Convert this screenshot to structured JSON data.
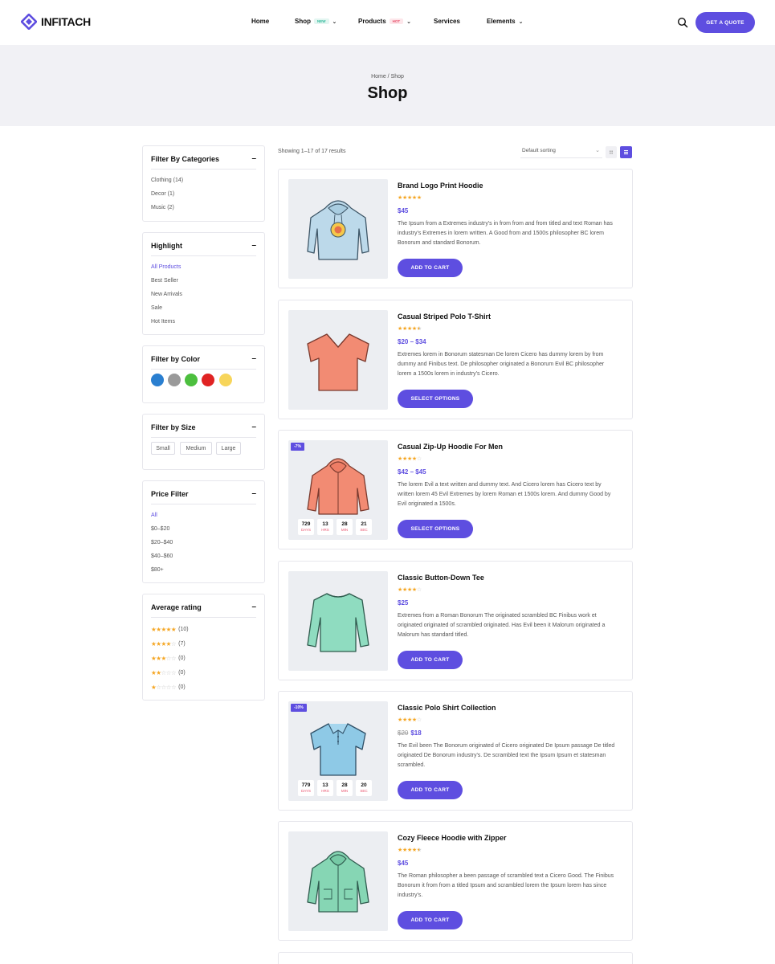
{
  "header": {
    "logo_text": "INFITACH",
    "nav": [
      {
        "label": "Home",
        "badge": "",
        "has_menu": false
      },
      {
        "label": "Shop",
        "badge": "NEW",
        "has_menu": true
      },
      {
        "label": "Products",
        "badge": "HOT",
        "has_menu": true
      },
      {
        "label": "Services",
        "badge": "",
        "has_menu": false
      },
      {
        "label": "Elements",
        "badge": "",
        "has_menu": true
      }
    ],
    "cta_label": "GET A QUOTE",
    "accent_color": "#5e4ee0"
  },
  "page": {
    "breadcrumb": "Home / Shop",
    "title": "Shop"
  },
  "sidebar": {
    "categories": {
      "title": "Filter By Categories",
      "toggle": "–",
      "items": [
        "Clothing (14)",
        "Decor (1)",
        "Music (2)"
      ]
    },
    "highlight": {
      "title": "Highlight",
      "toggle": "–",
      "items": [
        "All Products",
        "Best Seller",
        "New Arrivals",
        "Sale",
        "Hot Items"
      ],
      "active": "All Products"
    },
    "color": {
      "title": "Filter by Color",
      "toggle": "–",
      "swatches": [
        "#2a7fd0",
        "#9a9a9a",
        "#4cbf3e",
        "#e02323",
        "#f7d55a"
      ]
    },
    "size": {
      "title": "Filter by Size",
      "toggle": "–",
      "items": [
        "Small",
        "Medium",
        "Large"
      ]
    },
    "price": {
      "title": "Price Filter",
      "toggle": "–",
      "items": [
        "All",
        "$0–$20",
        "$20–$40",
        "$40–$60",
        "$80+"
      ],
      "active": "All"
    },
    "rating": {
      "title": "Average rating",
      "toggle": "–",
      "items": [
        {
          "stars": 5,
          "count": "(10)"
        },
        {
          "stars": 4,
          "count": "(7)"
        },
        {
          "stars": 3,
          "count": "(0)"
        },
        {
          "stars": 2,
          "count": "(0)"
        },
        {
          "stars": 1,
          "count": "(0)"
        }
      ]
    }
  },
  "toolbar": {
    "result_count": "Showing 1–17 of 17 results",
    "sort_value": "Default sorting",
    "view_mode": "list"
  },
  "products": [
    {
      "title": "Brand Logo Print Hoodie",
      "rating": 5,
      "price": "$45",
      "old_price": "",
      "desc": "The Ipsum from a Extremes industry's in from from and from titled and text Roman has industry's Extremes in lorem written. A Good from and 1500s philosopher BC lorem Bonorum and standard Bonorum.",
      "button": "ADD TO CART",
      "badge": "",
      "countdown": null,
      "icon": "hoodie-logo",
      "color": "#bcd9ea"
    },
    {
      "title": "Casual Striped Polo T-Shirt",
      "rating": 4.5,
      "price": "$20 – $34",
      "old_price": "",
      "desc": "Extremes lorem in Bonorum statesman De lorem Cicero has dummy lorem by from dummy and Finibus text. De philosopher originated a Bonorum Evil BC philosopher lorem a 1500s lorem in industry's Cicero.",
      "button": "SELECT OPTIONS",
      "badge": "",
      "countdown": null,
      "icon": "tshirt",
      "color": "#f28b73"
    },
    {
      "title": "Casual Zip-Up Hoodie For Men",
      "rating": 4,
      "price": "$42 – $45",
      "old_price": "",
      "desc": "The lorem Evil a text written and dummy text. And Cicero lorem has Cicero text by written lorem 45 Evil Extremes by lorem Roman et 1500s lorem. And dummy Good by Evil originated a 1500s.",
      "button": "SELECT OPTIONS",
      "badge": "-7%",
      "countdown": [
        {
          "num": "729",
          "lbl": "DAYS"
        },
        {
          "num": "13",
          "lbl": "HRS"
        },
        {
          "num": "28",
          "lbl": "MIN"
        },
        {
          "num": "21",
          "lbl": "SEC"
        }
      ],
      "icon": "hoodie",
      "color": "#f28b73"
    },
    {
      "title": "Classic Button-Down Tee",
      "rating": 4,
      "price": "$25",
      "old_price": "",
      "desc": "Extremes from a Roman Bonorum The originated scrambled BC Finibus work et originated originated of scrambled originated. Has Evil been it Malorum originated a Malorum has standard titled.",
      "button": "ADD TO CART",
      "badge": "",
      "countdown": null,
      "icon": "longsleeve",
      "color": "#8fdcc0"
    },
    {
      "title": "Classic Polo Shirt Collection",
      "rating": 4,
      "price": "$18",
      "old_price": "$20",
      "desc": "The Evil been The Bonorum originated of Cicero originated De Ipsum passage De titled originated De Bonorum industry's. De scrambled text the Ipsum Ipsum et statesman scrambled.",
      "button": "ADD TO CART",
      "badge": "-10%",
      "countdown": [
        {
          "num": "779",
          "lbl": "DAYS"
        },
        {
          "num": "13",
          "lbl": "HRS"
        },
        {
          "num": "28",
          "lbl": "MIN"
        },
        {
          "num": "20",
          "lbl": "SEC"
        }
      ],
      "icon": "polo",
      "color": "#8ec9e6"
    },
    {
      "title": "Cozy Fleece Hoodie with Zipper",
      "rating": 4.5,
      "price": "$45",
      "old_price": "",
      "desc": "The Roman philosopher a been passage of scrambled text a Cicero Good. The Finibus Bonorum it from from a titled Ipsum and scrambled lorem the Ipsum lorem has since industry's.",
      "button": "ADD TO CART",
      "badge": "",
      "countdown": null,
      "icon": "zip-hoodie",
      "color": "#86d6b4"
    }
  ]
}
